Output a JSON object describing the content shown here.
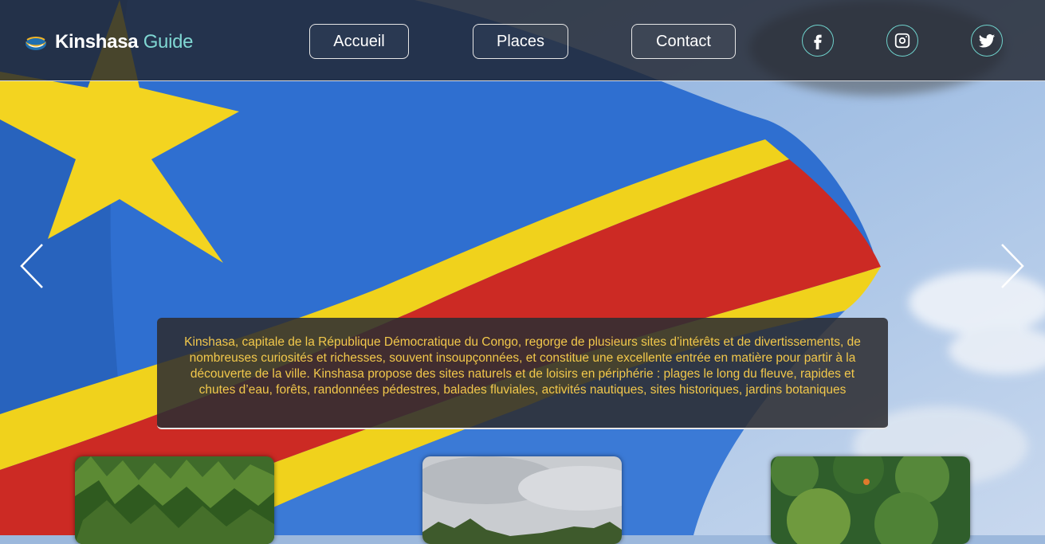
{
  "brand": {
    "name": "Kinshasa",
    "accent": "Guide",
    "icon": "boat-logo-icon"
  },
  "nav": [
    {
      "label": "Accueil"
    },
    {
      "label": "Places"
    },
    {
      "label": "Contact"
    }
  ],
  "social": [
    {
      "icon": "facebook-icon"
    },
    {
      "icon": "instagram-icon"
    },
    {
      "icon": "twitter-icon"
    }
  ],
  "carousel": {
    "prev_icon": "chevron-left-icon",
    "next_icon": "chevron-right-icon"
  },
  "caption": {
    "text": "Kinshasa, capitale de la République Démocratique du Congo, regorge de plusieurs sites d’intérêts et de divertissements, de nombreuses curiosités et richesses, souvent insoupçonnées, et constitue une excellente entrée en matière pour partir à la découverte de la ville. Kinshasa propose des sites naturels et de loisirs en périphérie : plages le long du fleuve, rapides et chutes d’eau, forêts, randonnées pédestres, balades fluviales, activités nautiques, sites historiques, jardins botaniques"
  },
  "colors": {
    "header_bg": "#222630",
    "accent": "#7fd6d2",
    "caption_text": "#f2c84b",
    "flag_blue": "#2f6fd0",
    "flag_yellow": "#f0d21c",
    "flag_red": "#cc2a24"
  }
}
